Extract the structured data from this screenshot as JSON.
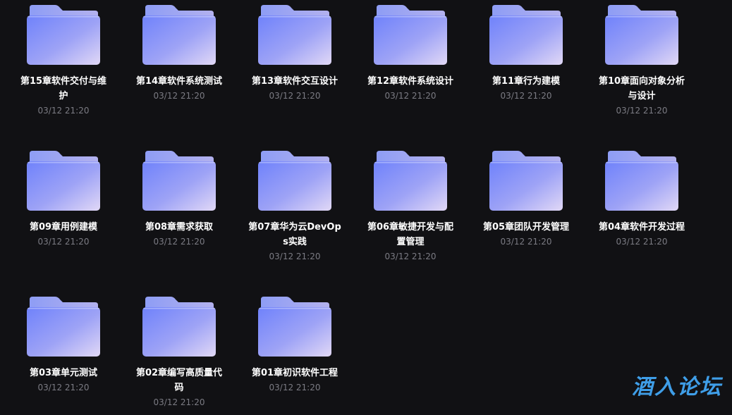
{
  "folders": [
    {
      "name": "第15章软件交付与维护",
      "date": "03/12 21:20"
    },
    {
      "name": "第14章软件系统测试",
      "date": "03/12 21:20"
    },
    {
      "name": "第13章软件交互设计",
      "date": "03/12 21:20"
    },
    {
      "name": "第12章软件系统设计",
      "date": "03/12 21:20"
    },
    {
      "name": "第11章行为建模",
      "date": "03/12 21:20"
    },
    {
      "name": "第10章面向对象分析与设计",
      "date": "03/12 21:20"
    },
    {
      "name": "第09章用例建模",
      "date": "03/12 21:20"
    },
    {
      "name": "第08章需求获取",
      "date": "03/12 21:20"
    },
    {
      "name": "第07章华为云DevOps实践",
      "date": "03/12 21:20"
    },
    {
      "name": "第06章敏捷开发与配置管理",
      "date": "03/12 21:20"
    },
    {
      "name": "第05章团队开发管理",
      "date": "03/12 21:20"
    },
    {
      "name": "第04章软件开发过程",
      "date": "03/12 21:20"
    },
    {
      "name": "第03章单元测试",
      "date": "03/12 21:20"
    },
    {
      "name": "第02章编写高质量代码",
      "date": "03/12 21:20"
    },
    {
      "name": "第01章初识软件工程",
      "date": "03/12 21:20"
    }
  ],
  "folder_icon": "folder-icon",
  "colors": {
    "background": "#111114",
    "folder_light": "#d9d2f7",
    "folder_dark": "#7486fb",
    "folder_back": "#99a6f2",
    "name_text": "#ffffff",
    "date_text": "#7b7b83",
    "watermark": "#3f9ee8"
  },
  "watermark": {
    "text": "酒入论坛"
  }
}
